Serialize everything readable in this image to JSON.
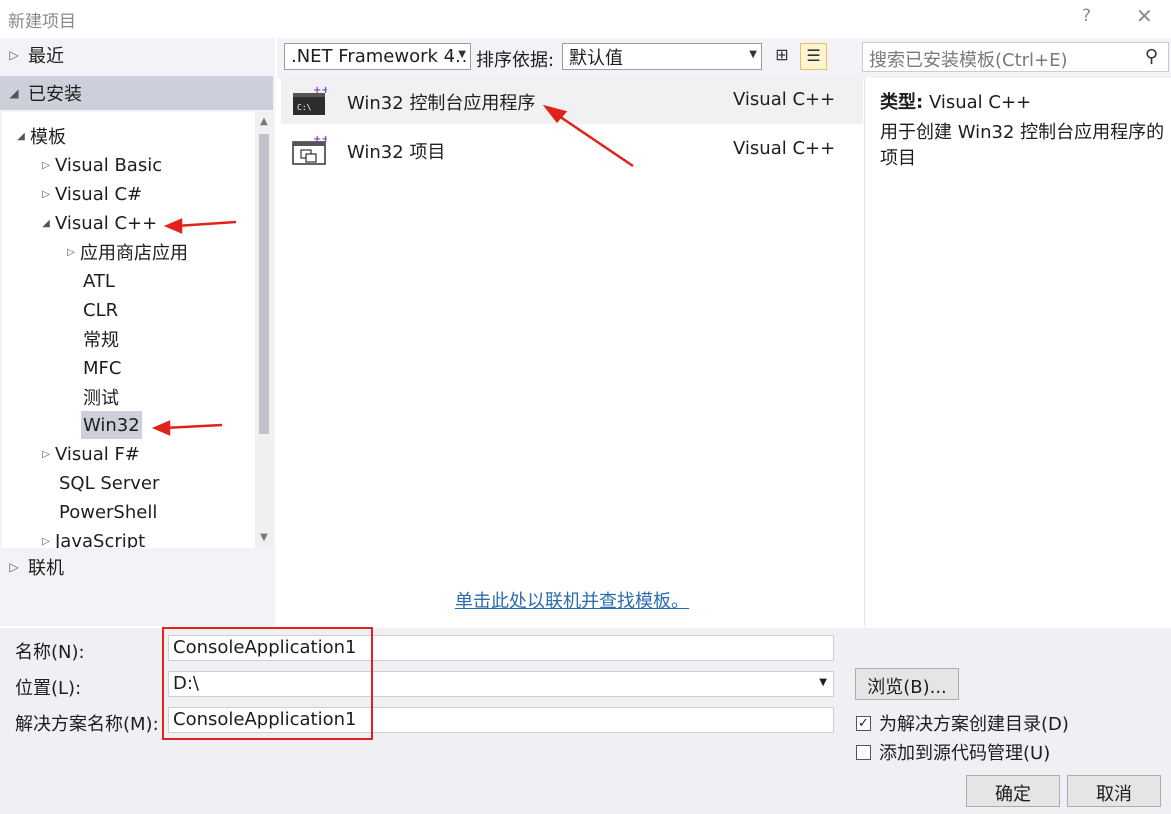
{
  "window": {
    "title": "新建项目",
    "help": "?",
    "close": "✕"
  },
  "left": {
    "recent": "最近",
    "installed": "已安装",
    "online": "联机",
    "tree": [
      {
        "label": "模板",
        "depth": 0,
        "arrow": "◢"
      },
      {
        "label": "Visual Basic",
        "depth": 1,
        "arrow": "▷"
      },
      {
        "label": "Visual C#",
        "depth": 1,
        "arrow": "▷"
      },
      {
        "label": "Visual C++",
        "depth": 1,
        "arrow": "◢"
      },
      {
        "label": "应用商店应用",
        "depth": 2,
        "arrow": "▷"
      },
      {
        "label": "ATL",
        "depth": 2,
        "arrow": ""
      },
      {
        "label": "CLR",
        "depth": 2,
        "arrow": ""
      },
      {
        "label": "常规",
        "depth": 2,
        "arrow": ""
      },
      {
        "label": "MFC",
        "depth": 2,
        "arrow": ""
      },
      {
        "label": "测试",
        "depth": 2,
        "arrow": ""
      },
      {
        "label": "Win32",
        "depth": 2,
        "arrow": ""
      },
      {
        "label": "Visual F#",
        "depth": 1,
        "arrow": "▷"
      },
      {
        "label": "SQL Server",
        "depth": 1,
        "arrow": ""
      },
      {
        "label": "PowerShell",
        "depth": 1,
        "arrow": ""
      },
      {
        "label": "JavaScript",
        "depth": 1,
        "arrow": "▷"
      }
    ]
  },
  "toolbar": {
    "framework": ".NET Framework 4.!",
    "sort_label": "排序依据:",
    "sort_value": "默认值",
    "search_placeholder": "搜索已安装模板(Ctrl+E)"
  },
  "templates": [
    {
      "name": "Win32 控制台应用程序",
      "lang": "Visual C++"
    },
    {
      "name": "Win32 项目",
      "lang": "Visual C++"
    }
  ],
  "online_link": "单击此处以联机并查找模板。",
  "details": {
    "type_label": "类型:",
    "type_value": "Visual C++",
    "description": "用于创建 Win32 控制台应用程序的项目"
  },
  "form": {
    "name_label": "名称(N):",
    "name_value": "ConsoleApplication1",
    "location_label": "位置(L):",
    "location_value": "D:\\",
    "solution_label": "解决方案名称(M):",
    "solution_value": "ConsoleApplication1",
    "browse": "浏览(B)...",
    "create_dir": "为解决方案创建目录(D)",
    "source_control": "添加到源代码管理(U)",
    "ok": "确定",
    "cancel": "取消"
  }
}
